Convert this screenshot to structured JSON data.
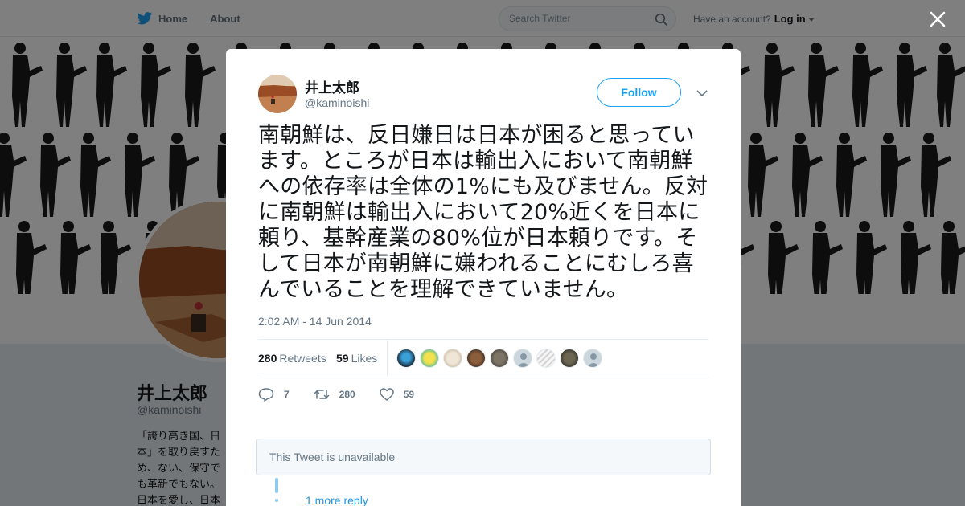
{
  "nav": {
    "home": "Home",
    "about": "About",
    "search_placeholder": "Search Twitter",
    "have_account": "Have an account?",
    "login": "Log in"
  },
  "profile": {
    "name": "井上太郎",
    "handle": "@kaminoishi",
    "bio": "「誇り高き国、日本」を取り戻すため、ない、保守でも革新でもない。日本を愛し、日本と日本人を守るだけ。根拠を示して誹謗中傷、生命をかけて日本を"
  },
  "tweet": {
    "author_name": "井上太郎",
    "author_handle": "@kaminoishi",
    "follow_label": "Follow",
    "text": "南朝鮮は、反日嫌日は日本が困ると思っています。ところが日本は輸出入において南朝鮮への依存率は全体の1%にも及びません。反対に南朝鮮は輸出入において20%近くを日本に頼り、基幹産業の80%位が日本頼りです。そして日本が南朝鮮に嫌われることにむしろ喜んでいることを理解できていません。",
    "timestamp": "2:02 AM - 14 Jun 2014",
    "retweets_count": "280",
    "retweets_label": "Retweets",
    "likes_count": "59",
    "likes_label": "Likes",
    "replies": "7",
    "retweet_action_count": "280",
    "like_action_count": "59"
  },
  "unavailable_text": "This Tweet is unavailable",
  "more_reply": "1 more reply",
  "colors": {
    "brand_blue": "#1da1f2",
    "text_dark": "#14171a",
    "text_gray": "#657786"
  }
}
